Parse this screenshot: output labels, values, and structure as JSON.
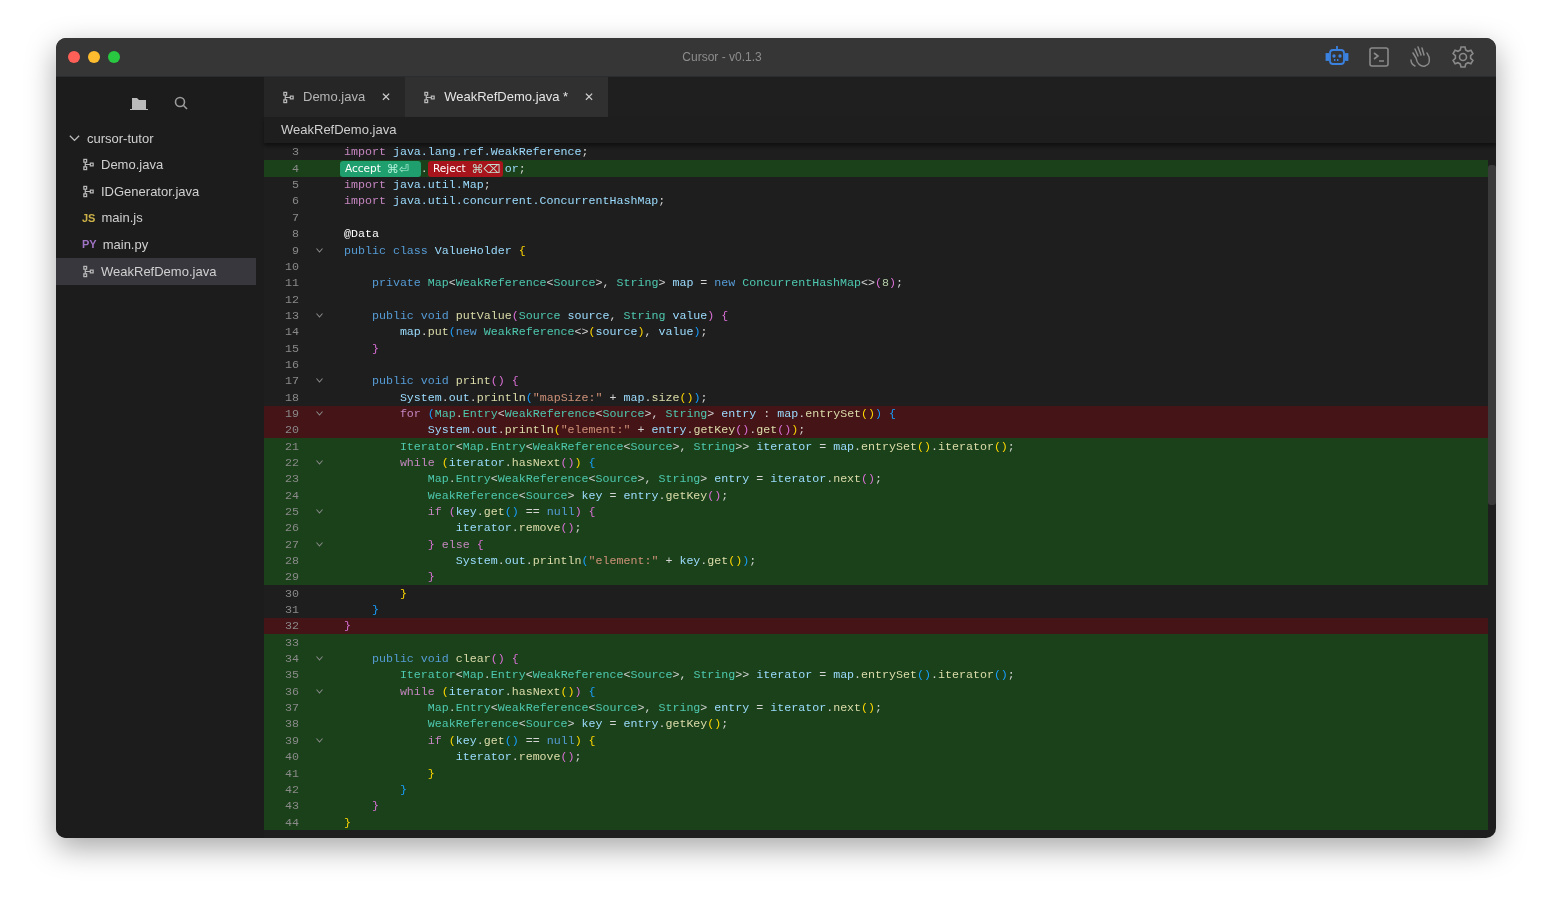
{
  "window": {
    "title": "Cursor - v0.1.3"
  },
  "toolbar": [
    {
      "kind": "robot",
      "selected": true
    },
    {
      "kind": "terminal",
      "selected": false
    },
    {
      "kind": "hand",
      "selected": false
    },
    {
      "kind": "gear",
      "selected": false
    }
  ],
  "sidebar": {
    "views": [
      {
        "kind": "folder",
        "selected": true
      },
      {
        "kind": "search",
        "selected": false
      }
    ],
    "tree": {
      "label": "cursor-tutor",
      "expanded": true,
      "children": [
        {
          "label": "Demo.java",
          "kind": "java",
          "selected": false
        },
        {
          "label": "IDGenerator.java",
          "kind": "java",
          "selected": false
        },
        {
          "label": "main.js",
          "kind": "badge",
          "badge": "JS",
          "color": "#cbb148",
          "selected": false
        },
        {
          "label": "main.py",
          "kind": "badge",
          "badge": "PY",
          "color": "#a074c4",
          "selected": false
        },
        {
          "label": "WeakRefDemo.java",
          "kind": "java",
          "selected": true
        }
      ]
    }
  },
  "tabs": [
    {
      "label": "Demo.java",
      "close": "✕",
      "selected": false
    },
    {
      "label": "WeakRefDemo.java *",
      "close": "✕",
      "selected": true
    }
  ],
  "breadcrumb": "WeakRefDemo.java",
  "diff_actions": [
    {
      "label": "Accept",
      "shortcut": "⌘⏎",
      "kind": "accept"
    },
    {
      "label": "Reject",
      "shortcut": "⌘⌫",
      "kind": "reject"
    }
  ],
  "lines": [
    {
      "n": "3",
      "kind": "context",
      "fold": false,
      "code": [
        {
          "text": "import ",
          "kind": "kw"
        },
        {
          "text": "java.lang.ref.WeakReference",
          "kind": "id"
        },
        {
          "text": ";",
          "kind": "pun"
        }
      ]
    },
    {
      "n": "4",
      "kind": "added",
      "fold": false,
      "code": [
        {
          "text": ".",
          "kind": "pun",
          "covered_before": true
        },
        {
          "text": "or",
          "kind": "id",
          "covered_before": true
        },
        {
          "text": ";",
          "kind": "pun"
        }
      ]
    },
    {
      "n": "5",
      "kind": "context",
      "fold": false,
      "code": [
        {
          "text": "import ",
          "kind": "kw"
        },
        {
          "text": "java.util.Map",
          "kind": "id"
        },
        {
          "text": ";",
          "kind": "pun"
        }
      ]
    },
    {
      "n": "6",
      "kind": "context",
      "fold": false,
      "code": [
        {
          "text": "import ",
          "kind": "kw"
        },
        {
          "text": "java.util.concurrent.ConcurrentHashMap",
          "kind": "id"
        },
        {
          "text": ";",
          "kind": "pun"
        }
      ]
    },
    {
      "n": "7",
      "kind": "context",
      "fold": false
    },
    {
      "n": "8",
      "kind": "context",
      "fold": false,
      "code": [
        {
          "text": "@Data",
          "kind": "ann"
        }
      ]
    },
    {
      "n": "9",
      "kind": "context",
      "fold": true,
      "code": [
        {
          "text": "public class ",
          "kind": "st"
        },
        {
          "text": "ValueHolder ",
          "kind": "id"
        },
        {
          "text": "{",
          "kind": "gold"
        }
      ]
    },
    {
      "n": "10",
      "kind": "context",
      "fold": false
    },
    {
      "n": "11",
      "kind": "context",
      "fold": false,
      "code": [
        {
          "text": "    private ",
          "kind": "st"
        },
        {
          "text": "Map",
          "kind": "ty"
        },
        {
          "text": "<",
          "kind": "pun"
        },
        {
          "text": "WeakReference",
          "kind": "ty"
        },
        {
          "text": "<",
          "kind": "pun"
        },
        {
          "text": "Source",
          "kind": "ty"
        },
        {
          "text": ">, ",
          "kind": "pun"
        },
        {
          "text": "String",
          "kind": "ty"
        },
        {
          "text": "> ",
          "kind": "pun"
        },
        {
          "text": "map ",
          "kind": "id"
        },
        {
          "text": "= ",
          "kind": "pun"
        },
        {
          "text": "new ",
          "kind": "st"
        },
        {
          "text": "ConcurrentHashMap",
          "kind": "ty"
        },
        {
          "text": "<>",
          "kind": "pun"
        },
        {
          "text": "(",
          "kind": "pink"
        },
        {
          "text": "8",
          "kind": "num"
        },
        {
          "text": ")",
          "kind": "pink"
        },
        {
          "text": ";",
          "kind": "pun"
        }
      ]
    },
    {
      "n": "12",
      "kind": "context",
      "fold": false
    },
    {
      "n": "13",
      "kind": "context",
      "fold": true,
      "code": [
        {
          "text": "    public void ",
          "kind": "st"
        },
        {
          "text": "putValue",
          "kind": "fn"
        },
        {
          "text": "(",
          "kind": "pink"
        },
        {
          "text": "Source ",
          "kind": "ty"
        },
        {
          "text": "source",
          "kind": "id"
        },
        {
          "text": ", ",
          "kind": "pun"
        },
        {
          "text": "String ",
          "kind": "ty"
        },
        {
          "text": "value",
          "kind": "id"
        },
        {
          "text": ") {",
          "kind": "pink"
        }
      ]
    },
    {
      "n": "14",
      "kind": "context",
      "fold": false,
      "code": [
        {
          "text": "        map",
          "kind": "id"
        },
        {
          "text": ".",
          "kind": "pun"
        },
        {
          "text": "put",
          "kind": "fn"
        },
        {
          "text": "(",
          "kind": "blue"
        },
        {
          "text": "new ",
          "kind": "st"
        },
        {
          "text": "WeakReference",
          "kind": "ty"
        },
        {
          "text": "<>",
          "kind": "pun"
        },
        {
          "text": "(",
          "kind": "gold"
        },
        {
          "text": "source",
          "kind": "id"
        },
        {
          "text": ")",
          "kind": "gold"
        },
        {
          "text": ", ",
          "kind": "pun"
        },
        {
          "text": "value",
          "kind": "id"
        },
        {
          "text": ")",
          "kind": "blue"
        },
        {
          "text": ";",
          "kind": "pun"
        }
      ]
    },
    {
      "n": "15",
      "kind": "context",
      "fold": false,
      "code": [
        {
          "text": "    }",
          "kind": "pink"
        }
      ]
    },
    {
      "n": "16",
      "kind": "context",
      "fold": false
    },
    {
      "n": "17",
      "kind": "context",
      "fold": true,
      "code": [
        {
          "text": "    public void ",
          "kind": "st"
        },
        {
          "text": "print",
          "kind": "fn"
        },
        {
          "text": "() {",
          "kind": "pink"
        }
      ]
    },
    {
      "n": "18",
      "kind": "context",
      "fold": false,
      "code": [
        {
          "text": "        System",
          "kind": "id"
        },
        {
          "text": ".",
          "kind": "pun"
        },
        {
          "text": "out",
          "kind": "id"
        },
        {
          "text": ".",
          "kind": "pun"
        },
        {
          "text": "println",
          "kind": "fn"
        },
        {
          "text": "(",
          "kind": "blue"
        },
        {
          "text": "\"mapSize:\"",
          "kind": "str"
        },
        {
          "text": " + ",
          "kind": "pun"
        },
        {
          "text": "map",
          "kind": "id"
        },
        {
          "text": ".",
          "kind": "pun"
        },
        {
          "text": "size",
          "kind": "fn"
        },
        {
          "text": "()",
          "kind": "gold"
        },
        {
          "text": ")",
          "kind": "blue"
        },
        {
          "text": ";",
          "kind": "pun"
        }
      ]
    },
    {
      "n": "19",
      "kind": "removed",
      "fold": true,
      "code": [
        {
          "text": "        for ",
          "kind": "kw"
        },
        {
          "text": "(",
          "kind": "blue"
        },
        {
          "text": "Map",
          "kind": "ty"
        },
        {
          "text": ".",
          "kind": "pun"
        },
        {
          "text": "Entry",
          "kind": "ty"
        },
        {
          "text": "<",
          "kind": "pun"
        },
        {
          "text": "WeakReference",
          "kind": "ty"
        },
        {
          "text": "<",
          "kind": "pun"
        },
        {
          "text": "Source",
          "kind": "ty"
        },
        {
          "text": ">, ",
          "kind": "pun"
        },
        {
          "text": "String",
          "kind": "ty"
        },
        {
          "text": "> ",
          "kind": "pun"
        },
        {
          "text": "entry ",
          "kind": "id"
        },
        {
          "text": ": ",
          "kind": "pun"
        },
        {
          "text": "map",
          "kind": "id"
        },
        {
          "text": ".",
          "kind": "pun"
        },
        {
          "text": "entrySet",
          "kind": "fn"
        },
        {
          "text": "()",
          "kind": "gold"
        },
        {
          "text": ") {",
          "kind": "blue"
        }
      ]
    },
    {
      "n": "20",
      "kind": "removed",
      "fold": false,
      "code": [
        {
          "text": "            System",
          "kind": "id"
        },
        {
          "text": ".",
          "kind": "pun"
        },
        {
          "text": "out",
          "kind": "id"
        },
        {
          "text": ".",
          "kind": "pun"
        },
        {
          "text": "println",
          "kind": "fn"
        },
        {
          "text": "(",
          "kind": "gold"
        },
        {
          "text": "\"element:\"",
          "kind": "str"
        },
        {
          "text": " + ",
          "kind": "pun"
        },
        {
          "text": "entry",
          "kind": "id"
        },
        {
          "text": ".",
          "kind": "pun"
        },
        {
          "text": "getKey",
          "kind": "fn"
        },
        {
          "text": "()",
          "kind": "pink"
        },
        {
          "text": ".",
          "kind": "pun"
        },
        {
          "text": "get",
          "kind": "fn"
        },
        {
          "text": "()",
          "kind": "pink"
        },
        {
          "text": ")",
          "kind": "gold"
        },
        {
          "text": ";",
          "kind": "pun"
        }
      ]
    },
    {
      "n": "21",
      "kind": "added",
      "fold": false,
      "code": [
        {
          "text": "        Iterator",
          "kind": "ty"
        },
        {
          "text": "<",
          "kind": "pun"
        },
        {
          "text": "Map",
          "kind": "ty"
        },
        {
          "text": ".",
          "kind": "pun"
        },
        {
          "text": "Entry",
          "kind": "ty"
        },
        {
          "text": "<",
          "kind": "pun"
        },
        {
          "text": "WeakReference",
          "kind": "ty"
        },
        {
          "text": "<",
          "kind": "pun"
        },
        {
          "text": "Source",
          "kind": "ty"
        },
        {
          "text": ">, ",
          "kind": "pun"
        },
        {
          "text": "String",
          "kind": "ty"
        },
        {
          "text": ">> ",
          "kind": "pun"
        },
        {
          "text": "iterator ",
          "kind": "id"
        },
        {
          "text": "= ",
          "kind": "pun"
        },
        {
          "text": "map",
          "kind": "id"
        },
        {
          "text": ".",
          "kind": "pun"
        },
        {
          "text": "entrySet",
          "kind": "fn"
        },
        {
          "text": "()",
          "kind": "gold"
        },
        {
          "text": ".",
          "kind": "pun"
        },
        {
          "text": "iterator",
          "kind": "fn"
        },
        {
          "text": "()",
          "kind": "gold"
        },
        {
          "text": ";",
          "kind": "pun"
        }
      ]
    },
    {
      "n": "22",
      "kind": "added",
      "fold": true,
      "code": [
        {
          "text": "        while ",
          "kind": "kw"
        },
        {
          "text": "(",
          "kind": "gold"
        },
        {
          "text": "iterator",
          "kind": "id"
        },
        {
          "text": ".",
          "kind": "pun"
        },
        {
          "text": "hasNext",
          "kind": "fn"
        },
        {
          "text": "()",
          "kind": "pink"
        },
        {
          "text": ") ",
          "kind": "gold"
        },
        {
          "text": "{",
          "kind": "blue"
        }
      ]
    },
    {
      "n": "23",
      "kind": "added",
      "fold": false,
      "code": [
        {
          "text": "            Map",
          "kind": "ty"
        },
        {
          "text": ".",
          "kind": "pun"
        },
        {
          "text": "Entry",
          "kind": "ty"
        },
        {
          "text": "<",
          "kind": "pun"
        },
        {
          "text": "WeakReference",
          "kind": "ty"
        },
        {
          "text": "<",
          "kind": "pun"
        },
        {
          "text": "Source",
          "kind": "ty"
        },
        {
          "text": ">, ",
          "kind": "pun"
        },
        {
          "text": "String",
          "kind": "ty"
        },
        {
          "text": "> ",
          "kind": "pun"
        },
        {
          "text": "entry ",
          "kind": "id"
        },
        {
          "text": "= ",
          "kind": "pun"
        },
        {
          "text": "iterator",
          "kind": "id"
        },
        {
          "text": ".",
          "kind": "pun"
        },
        {
          "text": "next",
          "kind": "fn"
        },
        {
          "text": "()",
          "kind": "pink"
        },
        {
          "text": ";",
          "kind": "pun"
        }
      ]
    },
    {
      "n": "24",
      "kind": "added",
      "fold": false,
      "code": [
        {
          "text": "            WeakReference",
          "kind": "ty"
        },
        {
          "text": "<",
          "kind": "pun"
        },
        {
          "text": "Source",
          "kind": "ty"
        },
        {
          "text": "> ",
          "kind": "pun"
        },
        {
          "text": "key ",
          "kind": "id"
        },
        {
          "text": "= ",
          "kind": "pun"
        },
        {
          "text": "entry",
          "kind": "id"
        },
        {
          "text": ".",
          "kind": "pun"
        },
        {
          "text": "getKey",
          "kind": "fn"
        },
        {
          "text": "()",
          "kind": "pink"
        },
        {
          "text": ";",
          "kind": "pun"
        }
      ]
    },
    {
      "n": "25",
      "kind": "added",
      "fold": true,
      "code": [
        {
          "text": "            if ",
          "kind": "kw"
        },
        {
          "text": "(",
          "kind": "pink"
        },
        {
          "text": "key",
          "kind": "id"
        },
        {
          "text": ".",
          "kind": "pun"
        },
        {
          "text": "get",
          "kind": "fn"
        },
        {
          "text": "() ",
          "kind": "blue"
        },
        {
          "text": "== ",
          "kind": "pun"
        },
        {
          "text": "null",
          "kind": "st"
        },
        {
          "text": ") {",
          "kind": "pink"
        }
      ]
    },
    {
      "n": "26",
      "kind": "added",
      "fold": false,
      "code": [
        {
          "text": "                iterator",
          "kind": "id"
        },
        {
          "text": ".",
          "kind": "pun"
        },
        {
          "text": "remove",
          "kind": "fn"
        },
        {
          "text": "()",
          "kind": "pink"
        },
        {
          "text": ";",
          "kind": "pun"
        }
      ]
    },
    {
      "n": "27",
      "kind": "added",
      "fold": true,
      "code": [
        {
          "text": "            } ",
          "kind": "pink"
        },
        {
          "text": "else ",
          "kind": "kw"
        },
        {
          "text": "{",
          "kind": "pink"
        }
      ]
    },
    {
      "n": "28",
      "kind": "added",
      "fold": false,
      "code": [
        {
          "text": "                System",
          "kind": "id"
        },
        {
          "text": ".",
          "kind": "pun"
        },
        {
          "text": "out",
          "kind": "id"
        },
        {
          "text": ".",
          "kind": "pun"
        },
        {
          "text": "println",
          "kind": "fn"
        },
        {
          "text": "(",
          "kind": "blue"
        },
        {
          "text": "\"element:\"",
          "kind": "str"
        },
        {
          "text": " + ",
          "kind": "pun"
        },
        {
          "text": "key",
          "kind": "id"
        },
        {
          "text": ".",
          "kind": "pun"
        },
        {
          "text": "get",
          "kind": "fn"
        },
        {
          "text": "()",
          "kind": "gold"
        },
        {
          "text": ")",
          "kind": "blue"
        },
        {
          "text": ";",
          "kind": "pun"
        }
      ]
    },
    {
      "n": "29",
      "kind": "added",
      "fold": false,
      "code": [
        {
          "text": "            }",
          "kind": "pink"
        }
      ]
    },
    {
      "n": "30",
      "kind": "context",
      "fold": false,
      "code": [
        {
          "text": "        }",
          "kind": "gold"
        }
      ]
    },
    {
      "n": "31",
      "kind": "context",
      "fold": false,
      "code": [
        {
          "text": "    }",
          "kind": "blue"
        }
      ]
    },
    {
      "n": "32",
      "kind": "removed",
      "fold": false,
      "code": [
        {
          "text": "}",
          "kind": "pink"
        }
      ]
    },
    {
      "n": "33",
      "kind": "added",
      "fold": false
    },
    {
      "n": "34",
      "kind": "added",
      "fold": true,
      "code": [
        {
          "text": "    public void ",
          "kind": "st"
        },
        {
          "text": "clear",
          "kind": "fn"
        },
        {
          "text": "() {",
          "kind": "pink"
        }
      ]
    },
    {
      "n": "35",
      "kind": "added",
      "fold": false,
      "code": [
        {
          "text": "        Iterator",
          "kind": "ty"
        },
        {
          "text": "<",
          "kind": "pun"
        },
        {
          "text": "Map",
          "kind": "ty"
        },
        {
          "text": ".",
          "kind": "pun"
        },
        {
          "text": "Entry",
          "kind": "ty"
        },
        {
          "text": "<",
          "kind": "pun"
        },
        {
          "text": "WeakReference",
          "kind": "ty"
        },
        {
          "text": "<",
          "kind": "pun"
        },
        {
          "text": "Source",
          "kind": "ty"
        },
        {
          "text": ">, ",
          "kind": "pun"
        },
        {
          "text": "String",
          "kind": "ty"
        },
        {
          "text": ">> ",
          "kind": "pun"
        },
        {
          "text": "iterator ",
          "kind": "id"
        },
        {
          "text": "= ",
          "kind": "pun"
        },
        {
          "text": "map",
          "kind": "id"
        },
        {
          "text": ".",
          "kind": "pun"
        },
        {
          "text": "entrySet",
          "kind": "fn"
        },
        {
          "text": "()",
          "kind": "blue"
        },
        {
          "text": ".",
          "kind": "pun"
        },
        {
          "text": "iterator",
          "kind": "fn"
        },
        {
          "text": "()",
          "kind": "blue"
        },
        {
          "text": ";",
          "kind": "pun"
        }
      ]
    },
    {
      "n": "36",
      "kind": "added",
      "fold": true,
      "code": [
        {
          "text": "        while ",
          "kind": "kw"
        },
        {
          "text": "(",
          "kind": "gold"
        },
        {
          "text": "iterator",
          "kind": "id"
        },
        {
          "text": ".",
          "kind": "pun"
        },
        {
          "text": "hasNext",
          "kind": "fn"
        },
        {
          "text": "()",
          "kind": "gold"
        },
        {
          "text": ") ",
          "kind": "pink"
        },
        {
          "text": "{",
          "kind": "blue"
        }
      ]
    },
    {
      "n": "37",
      "kind": "added",
      "fold": false,
      "code": [
        {
          "text": "            Map",
          "kind": "ty"
        },
        {
          "text": ".",
          "kind": "pun"
        },
        {
          "text": "Entry",
          "kind": "ty"
        },
        {
          "text": "<",
          "kind": "pun"
        },
        {
          "text": "WeakReference",
          "kind": "ty"
        },
        {
          "text": "<",
          "kind": "pun"
        },
        {
          "text": "Source",
          "kind": "ty"
        },
        {
          "text": ">, ",
          "kind": "pun"
        },
        {
          "text": "String",
          "kind": "ty"
        },
        {
          "text": "> ",
          "kind": "pun"
        },
        {
          "text": "entry ",
          "kind": "id"
        },
        {
          "text": "= ",
          "kind": "pun"
        },
        {
          "text": "iterator",
          "kind": "id"
        },
        {
          "text": ".",
          "kind": "pun"
        },
        {
          "text": "next",
          "kind": "fn"
        },
        {
          "text": "()",
          "kind": "gold"
        },
        {
          "text": ";",
          "kind": "pun"
        }
      ]
    },
    {
      "n": "38",
      "kind": "added",
      "fold": false,
      "code": [
        {
          "text": "            WeakReference",
          "kind": "ty"
        },
        {
          "text": "<",
          "kind": "pun"
        },
        {
          "text": "Source",
          "kind": "ty"
        },
        {
          "text": "> ",
          "kind": "pun"
        },
        {
          "text": "key ",
          "kind": "id"
        },
        {
          "text": "= ",
          "kind": "pun"
        },
        {
          "text": "entry",
          "kind": "id"
        },
        {
          "text": ".",
          "kind": "pun"
        },
        {
          "text": "getKey",
          "kind": "fn"
        },
        {
          "text": "()",
          "kind": "gold"
        },
        {
          "text": ";",
          "kind": "pun"
        }
      ]
    },
    {
      "n": "39",
      "kind": "added",
      "fold": true,
      "code": [
        {
          "text": "            if ",
          "kind": "kw"
        },
        {
          "text": "(",
          "kind": "gold"
        },
        {
          "text": "key",
          "kind": "id"
        },
        {
          "text": ".",
          "kind": "pun"
        },
        {
          "text": "get",
          "kind": "fn"
        },
        {
          "text": "() ",
          "kind": "blue"
        },
        {
          "text": "== ",
          "kind": "pun"
        },
        {
          "text": "null",
          "kind": "st"
        },
        {
          "text": ") {",
          "kind": "gold"
        }
      ]
    },
    {
      "n": "40",
      "kind": "added",
      "fold": false,
      "code": [
        {
          "text": "                iterator",
          "kind": "id"
        },
        {
          "text": ".",
          "kind": "pun"
        },
        {
          "text": "remove",
          "kind": "fn"
        },
        {
          "text": "()",
          "kind": "pink"
        },
        {
          "text": ";",
          "kind": "pun"
        }
      ]
    },
    {
      "n": "41",
      "kind": "added",
      "fold": false,
      "code": [
        {
          "text": "            }",
          "kind": "gold"
        }
      ]
    },
    {
      "n": "42",
      "kind": "added",
      "fold": false,
      "code": [
        {
          "text": "        }",
          "kind": "blue"
        }
      ]
    },
    {
      "n": "43",
      "kind": "added",
      "fold": false,
      "code": [
        {
          "text": "    }",
          "kind": "pink"
        }
      ]
    },
    {
      "n": "44",
      "kind": "added",
      "fold": false,
      "code": [
        {
          "text": "}",
          "kind": "gold"
        }
      ]
    }
  ]
}
